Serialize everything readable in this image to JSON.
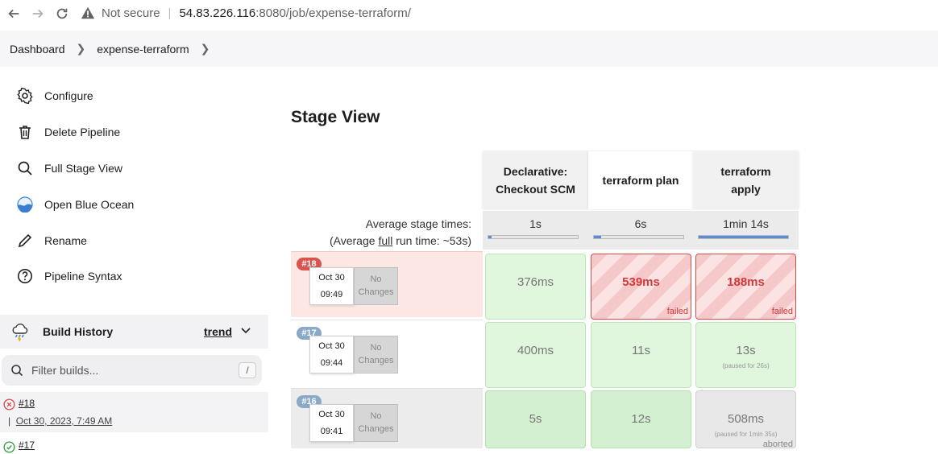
{
  "browser": {
    "security_label": "Not secure",
    "host": "54.83.226.116",
    "path": ":8080/job/expense-terraform/"
  },
  "breadcrumb": [
    "Dashboard",
    "expense-terraform"
  ],
  "sidebar": {
    "items": [
      {
        "label": "Configure",
        "icon": "gear-icon"
      },
      {
        "label": "Delete Pipeline",
        "icon": "trash-icon"
      },
      {
        "label": "Full Stage View",
        "icon": "search-icon"
      },
      {
        "label": "Open Blue Ocean",
        "icon": "blue-ocean-icon"
      },
      {
        "label": "Rename",
        "icon": "pencil-icon"
      },
      {
        "label": "Pipeline Syntax",
        "icon": "help-icon"
      }
    ],
    "build_history": {
      "title": "Build History",
      "trend": "trend",
      "filter_placeholder": "Filter builds...",
      "shortcut": "/",
      "builds": [
        {
          "number": "#18",
          "date": "Oct 30, 2023, 7:49 AM",
          "status": "failed"
        },
        {
          "number": "#17",
          "status": "success"
        }
      ]
    }
  },
  "main": {
    "title": "Stage View",
    "columns": [
      "Declarative: Checkout SCM",
      "terraform plan",
      "terraform apply"
    ],
    "avg_label_1": "Average stage times:",
    "avg_label_2_pre": "(Average ",
    "avg_label_2_link": "full",
    "avg_label_2_post": " run time: ~53s)",
    "avg_times": [
      "1s",
      "6s",
      "1min 14s"
    ],
    "avg_bar_fraction": [
      0.01,
      0.08,
      1.0
    ],
    "no_changes_1": "No",
    "no_changes_2": "Changes",
    "runs": [
      {
        "badge": "#18",
        "date": "Oct 30",
        "time": "09:49",
        "cells": [
          {
            "value": "376ms",
            "status": "success"
          },
          {
            "value": "539ms",
            "status": "failed",
            "tag": "failed"
          },
          {
            "value": "188ms",
            "status": "failed",
            "tag": "failed"
          }
        ]
      },
      {
        "badge": "#17",
        "date": "Oct 30",
        "time": "09:44",
        "cells": [
          {
            "value": "400ms",
            "status": "success"
          },
          {
            "value": "11s",
            "status": "success"
          },
          {
            "value": "13s",
            "status": "success",
            "note": "(paused for 26s)"
          }
        ]
      },
      {
        "badge": "#16",
        "date": "Oct 30",
        "time": "09:41",
        "cells": [
          {
            "value": "5s",
            "status": "success"
          },
          {
            "value": "12s",
            "status": "success"
          },
          {
            "value": "508ms",
            "status": "aborted",
            "note": "(paused for 1min 35s)",
            "tag": "aborted"
          }
        ]
      }
    ]
  },
  "colors": {
    "failed_red": "#d94a4a",
    "badge_fail": "#d9534f",
    "badge_ok": "#8aa8c8",
    "success_green": "#e0f7dd",
    "progress_blue": "#5b8bd8"
  }
}
